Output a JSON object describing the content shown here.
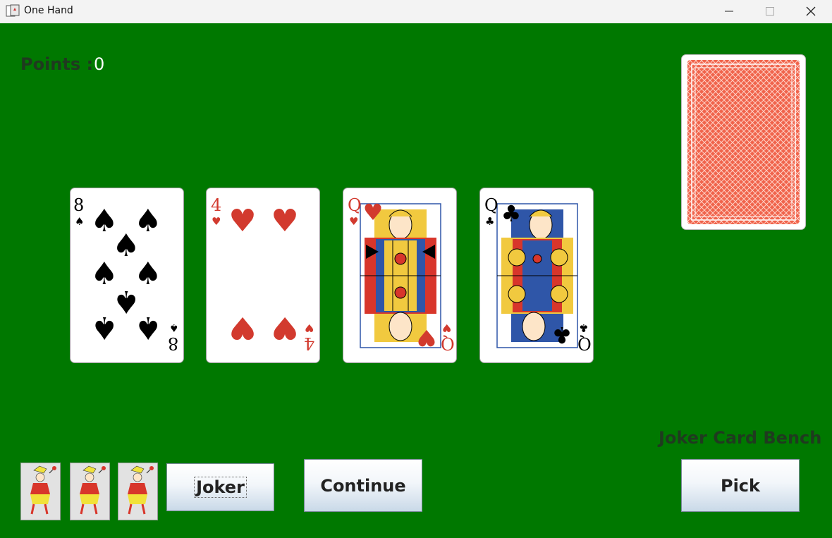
{
  "window": {
    "title": "One Hand",
    "icon": "app-cards-icon"
  },
  "score": {
    "label": "Points :",
    "value": "0"
  },
  "hand": [
    {
      "rank": "8",
      "suit": "♠",
      "suit_name": "spades",
      "color": "#000000"
    },
    {
      "rank": "4",
      "suit": "♥",
      "suit_name": "hearts",
      "color": "#d23a2e"
    },
    {
      "rank": "Q",
      "suit": "♥",
      "suit_name": "hearts",
      "color": "#d23a2e"
    },
    {
      "rank": "Q",
      "suit": "♣",
      "suit_name": "clubs",
      "color": "#000000"
    }
  ],
  "deck": {
    "back_color": "#f0644c"
  },
  "bench": {
    "label": "Joker Card Bench",
    "joker_count": 3
  },
  "buttons": {
    "joker": "Joker",
    "continue": "Continue",
    "pick": "Pick"
  },
  "colors": {
    "felt": "#007800",
    "label": "#1f3a1f"
  }
}
